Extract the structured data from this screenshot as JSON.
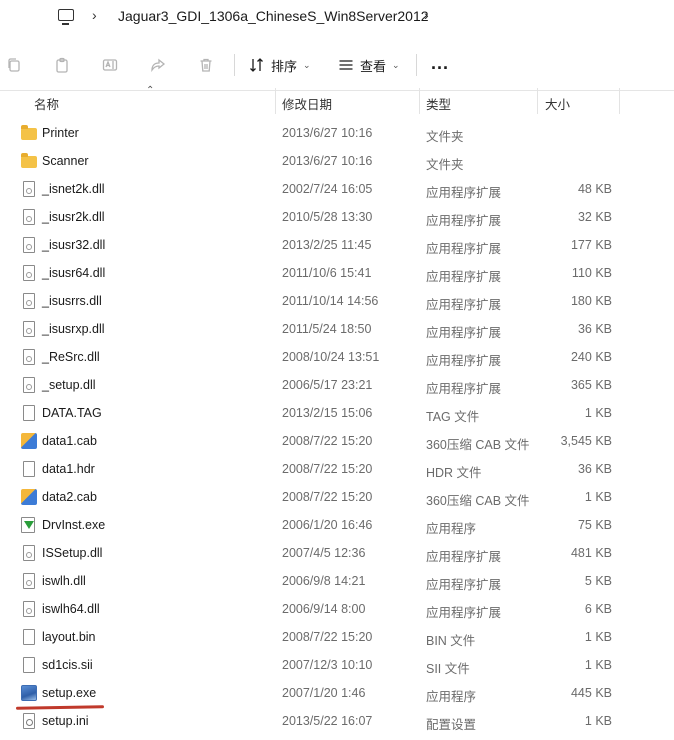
{
  "address": {
    "computer_icon": "computer-icon",
    "path": "Jaguar3_GDI_1306a_ChineseS_Win8Server2012"
  },
  "toolbar": {
    "icons": [
      "copy-icon",
      "paste-icon",
      "rename-icon",
      "share-icon",
      "delete-icon"
    ],
    "sort_label": "排序",
    "view_label": "查看",
    "more_label": "..."
  },
  "columns": {
    "name": "名称",
    "date": "修改日期",
    "type": "类型",
    "size": "大小"
  },
  "files": [
    {
      "name": "Printer",
      "date": "2013/6/27 10:16",
      "type": "文件夹",
      "size": "",
      "icon": "folder-icon"
    },
    {
      "name": "Scanner",
      "date": "2013/6/27 10:16",
      "type": "文件夹",
      "size": "",
      "icon": "folder-icon"
    },
    {
      "name": "_isnet2k.dll",
      "date": "2002/7/24 16:05",
      "type": "应用程序扩展",
      "size": "48 KB",
      "icon": "dll-icon"
    },
    {
      "name": "_isusr2k.dll",
      "date": "2010/5/28 13:30",
      "type": "应用程序扩展",
      "size": "32 KB",
      "icon": "dll-icon"
    },
    {
      "name": "_isusr32.dll",
      "date": "2013/2/25 11:45",
      "type": "应用程序扩展",
      "size": "177 KB",
      "icon": "dll-icon"
    },
    {
      "name": "_isusr64.dll",
      "date": "2011/10/6 15:41",
      "type": "应用程序扩展",
      "size": "110 KB",
      "icon": "dll-icon"
    },
    {
      "name": "_isusrrs.dll",
      "date": "2011/10/14 14:56",
      "type": "应用程序扩展",
      "size": "180 KB",
      "icon": "dll-icon"
    },
    {
      "name": "_isusrxp.dll",
      "date": "2011/5/24 18:50",
      "type": "应用程序扩展",
      "size": "36 KB",
      "icon": "dll-icon"
    },
    {
      "name": "_ReSrc.dll",
      "date": "2008/10/24 13:51",
      "type": "应用程序扩展",
      "size": "240 KB",
      "icon": "dll-icon"
    },
    {
      "name": "_setup.dll",
      "date": "2006/5/17 23:21",
      "type": "应用程序扩展",
      "size": "365 KB",
      "icon": "dll-icon"
    },
    {
      "name": "DATA.TAG",
      "date": "2013/2/15 15:06",
      "type": "TAG 文件",
      "size": "1 KB",
      "icon": "file-icon"
    },
    {
      "name": "data1.cab",
      "date": "2008/7/22 15:20",
      "type": "360压缩 CAB 文件",
      "size": "3,545 KB",
      "icon": "cab-archive-icon"
    },
    {
      "name": "data1.hdr",
      "date": "2008/7/22 15:20",
      "type": "HDR 文件",
      "size": "36 KB",
      "icon": "file-icon"
    },
    {
      "name": "data2.cab",
      "date": "2008/7/22 15:20",
      "type": "360压缩 CAB 文件",
      "size": "1 KB",
      "icon": "cab-archive-icon"
    },
    {
      "name": "DrvInst.exe",
      "date": "2006/1/20 16:46",
      "type": "应用程序",
      "size": "75 KB",
      "icon": "installer-exe-icon"
    },
    {
      "name": "ISSetup.dll",
      "date": "2007/4/5 12:36",
      "type": "应用程序扩展",
      "size": "481 KB",
      "icon": "dll-icon"
    },
    {
      "name": "iswlh.dll",
      "date": "2006/9/8 14:21",
      "type": "应用程序扩展",
      "size": "5 KB",
      "icon": "dll-icon"
    },
    {
      "name": "iswlh64.dll",
      "date": "2006/9/14 8:00",
      "type": "应用程序扩展",
      "size": "6 KB",
      "icon": "dll-icon"
    },
    {
      "name": "layout.bin",
      "date": "2008/7/22 15:20",
      "type": "BIN 文件",
      "size": "1 KB",
      "icon": "file-icon"
    },
    {
      "name": "sd1cis.sii",
      "date": "2007/12/3 10:10",
      "type": "SII 文件",
      "size": "1 KB",
      "icon": "file-icon"
    },
    {
      "name": "setup.exe",
      "date": "2007/1/20 1:46",
      "type": "应用程序",
      "size": "445 KB",
      "icon": "setup-exe-icon"
    },
    {
      "name": "setup.ini",
      "date": "2013/5/22 16:07",
      "type": "配置设置",
      "size": "1 KB",
      "icon": "config-file-icon"
    }
  ],
  "colors": {
    "highlight_underline": "#c0392b",
    "folder": "#f4c247"
  }
}
